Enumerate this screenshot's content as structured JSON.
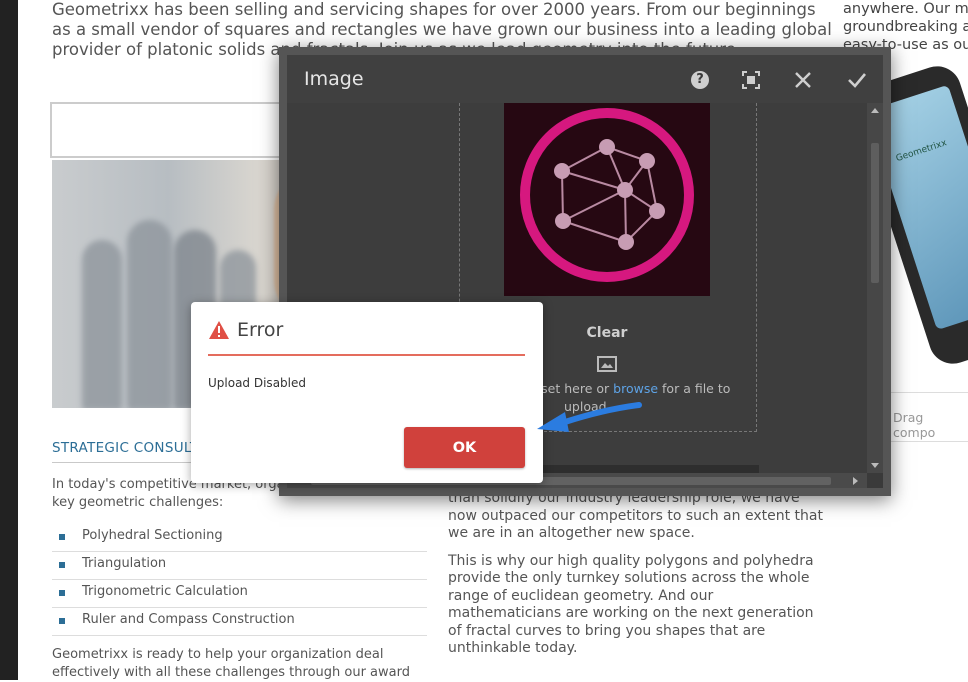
{
  "page": {
    "intro": "Geometrixx has been selling and servicing shapes for over 2000 years. From our beginnings as a small vendor of squares and rectangles we have grown our business into a leading global provider of platonic solids and fractals. Join us as we lead geometry into the future.",
    "right_text": "anywhere. Our mo groundbreaking a easy-to-use as ou",
    "section_title": "STRATEGIC CONSULTING",
    "section_para": "In today's competitive market, organizations face several key geometric challenges:",
    "bullets": [
      "Polyhedral Sectioning",
      "Triangulation",
      "Trigonometric Calculation",
      "Ruler and Compass Construction"
    ],
    "closing": "Geometrixx is ready to help your organization deal effectively with all these challenges through our award",
    "mid_para1": "than solidify our industry leadership role, we have now outpaced our competitors to such an extent that we are in an altogether new space.",
    "mid_para2": "This is why our high quality polygons and polyhedra provide the only turnkey solutions across the whole range of euclidean geometry. And our mathematicians are working on the next generation of fractal curves to bring you shapes that are unthinkable today.",
    "phone_brand": "Geometrixx",
    "drag_text": "Drag compo"
  },
  "image_dialog": {
    "title": "Image",
    "clear_label": "Clear",
    "drop_text_before": "asset here or",
    "drop_link": "browse",
    "drop_text_after": "for a file to",
    "drop_text_line2": "upload"
  },
  "error_dialog": {
    "title": "Error",
    "message": "Upload Disabled",
    "ok_label": "OK",
    "accent": "#e46c5d",
    "button_color": "#d0413c"
  },
  "icons": {
    "help": "?",
    "fullscreen": "fullscreen-icon",
    "close": "close-icon",
    "done": "checkmark-icon",
    "warning": "warning-icon",
    "image": "image-icon"
  }
}
